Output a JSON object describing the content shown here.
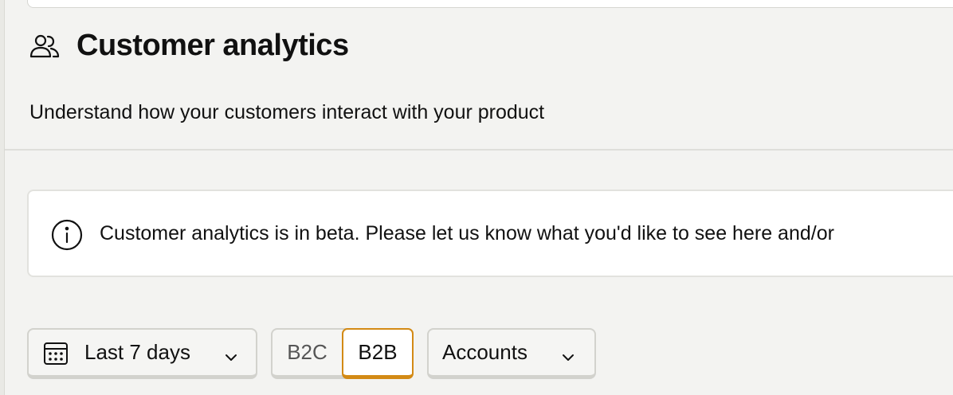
{
  "page": {
    "title": "Customer analytics",
    "subtitle": "Understand how your customers interact with your product",
    "title_icon": "users-icon"
  },
  "banner": {
    "icon": "info-icon",
    "text": "Customer analytics is in beta. Please let us know what you'd like to see here and/or"
  },
  "filters": {
    "date_range": {
      "icon": "calendar-icon",
      "label": "Last 7 days"
    },
    "mode_toggle": {
      "options": [
        "B2C",
        "B2B"
      ],
      "selected": "B2B"
    },
    "group_select": {
      "label": "Accounts"
    }
  },
  "colors": {
    "background": "#f3f3f1",
    "accent": "#d38a15",
    "card": "#ffffff"
  }
}
